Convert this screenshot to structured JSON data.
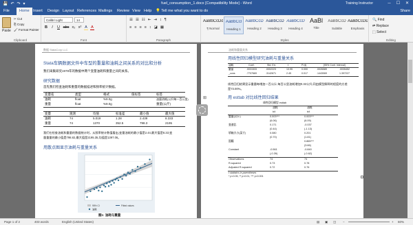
{
  "window": {
    "title": "fuel_consumption_1.docx [Compatibility Mode] - Word",
    "user": "Training Instructor",
    "quick_access": [
      "💾",
      "↶",
      "↷",
      "▾"
    ],
    "controls": {
      "minimize": "─",
      "maximize": "☐",
      "close": "✕"
    }
  },
  "tabs": [
    {
      "label": "File"
    },
    {
      "label": "Home"
    },
    {
      "label": "Insert"
    },
    {
      "label": "Design"
    },
    {
      "label": "Layout"
    },
    {
      "label": "References"
    },
    {
      "label": "Mailings"
    },
    {
      "label": "Review"
    },
    {
      "label": "View"
    },
    {
      "label": "Help"
    }
  ],
  "tell_me": "Tell me what you want to do",
  "share": "Share",
  "ribbon": {
    "clipboard": {
      "paste": "Paste",
      "cut": "Cut",
      "copy": "Copy",
      "format_painter": "Format Painter",
      "label": "Clipboard"
    },
    "font": {
      "name": "Calibri Light",
      "size": "14",
      "label": "Font",
      "buttons": [
        "B",
        "I",
        "U",
        "abc",
        "x₂",
        "x²",
        "A",
        "A"
      ]
    },
    "paragraph": {
      "label": "Paragraph",
      "row1": [
        "☰",
        "☰",
        "☷",
        "⇤",
        "⇥",
        "↕",
        "¶"
      ],
      "row2": [
        "≡",
        "≡",
        "≡",
        "≡",
        "↕",
        "◪",
        "▦"
      ]
    },
    "styles": {
      "label": "Styles",
      "items": [
        {
          "sample": "AaBbCcDd",
          "name": "¶ Normal"
        },
        {
          "sample": "AaBbCcl",
          "name": "Heading 1"
        },
        {
          "sample": "AaBbCcD",
          "name": "Heading 2"
        },
        {
          "sample": "AaBbCcD",
          "name": "Heading 3"
        },
        {
          "sample": "AaBbCcD",
          "name": "Heading 4"
        },
        {
          "sample": "AaBl",
          "name": "Title"
        },
        {
          "sample": "AaBbCcD",
          "name": "Subtitle"
        },
        {
          "sample": "AaBbCcDd",
          "name": "Emphasis"
        }
      ]
    },
    "editing": {
      "find": "Find",
      "replace": "Replace",
      "select": "Select",
      "label": "Editing"
    }
  },
  "left_page": {
    "header": "数据 StataCorp LLC",
    "title": "Stata车辆数据文件中车型的重量和油耗之间关系的对比和分析",
    "intro": "我们采集研究1978年的数据中两个变量油耗和重量之间的关系。",
    "h1": "研究数据",
    "p1": "首先我们检查油耗和重量的数据描述和频率统计数据。",
    "table1": {
      "headers": [
        "变量名",
        "类型",
        "格式",
        "值标签",
        "标签"
      ],
      "rows": [
        [
          "油耗",
          "float",
          "%9.0g",
          "",
          "油量消耗(公升每一百公里)"
        ],
        [
          "重量",
          "float",
          "%9.0g",
          "",
          "重量(公斤)"
        ]
      ]
    },
    "table2": {
      "headers": [
        "变量",
        "观测",
        "均值",
        "标准差",
        "最小值",
        "最大值"
      ],
      "rows": [
        [
          "油耗",
          "74",
          "5.019",
          "1.28",
          "2.439",
          "8.333"
        ],
        [
          "重量",
          "74",
          "1370",
          "352.5",
          "798.3",
          "2195"
        ]
      ]
    },
    "p2_line1": "我们在检查油耗和重量的数据统计时，从频率统计数值看出,变量油耗的最小值是2.44,最大值是8.33;变",
    "p2_line2": "量重量的最小值是798.82,最大值是2195.35,均值是1397.06。",
    "h2": "用散点图显示油耗与重量关系",
    "figure_caption": "图1: 油耗与重量",
    "chart_legend": [
      "95% CI",
      "Fitted values",
      "油耗"
    ]
  },
  "right_page": {
    "header": "油耗和重量关系",
    "h1": "用线性回归模型研究油耗与重量关系",
    "reg_table": {
      "headers": [
        "油耗",
        "Coef.",
        "Std. Err.",
        "t",
        "P>|t|",
        "[95% Conf. Interval]"
      ],
      "rows": [
        [
          "重量",
          ".0031533",
          ".0002223",
          "13.95",
          "0.000",
          ".0026589",
          ".0035452"
        ],
        [
          "_cons",
          ".7707669",
          ".3142671",
          "2.45",
          "0.017",
          ".1443069",
          "1.397227"
        ]
      ]
    },
    "p1_line1": "线性回归结果显示重量每增加一百公斤,每百公里油耗增加0.32公升,同由模型解释的程度的方差",
    "p1_line2": "是73.00%。",
    "h2": "用 esttab 对比线性回归结果",
    "esttab": {
      "caption": "线性回归模型 esttab",
      "col_headers": [
        "油耗",
        "油耗"
      ],
      "col_sub": [
        "b/t",
        "b/t"
      ],
      "rows": [
        {
          "label": "重量(公斤)",
          "c1": "0.003***",
          "c2": "0.003***"
        },
        {
          "label": "",
          "c1": "(6.06)",
          "c2": "(6.09)"
        },
        {
          "label": "变速比",
          "c1": "0.171",
          "c2": "-0.037"
        },
        {
          "label": "",
          "c1": "(0.44)",
          "c2": "(-1.13)"
        },
        {
          "label": "轿箱大小(英寸)",
          "c1": "0.080",
          "c2": "0.201"
        },
        {
          "label": "",
          "c1": "(0.70)",
          "c2": "(1.81)"
        },
        {
          "label": "国籍",
          "c1": "",
          "c2": "0.865***"
        },
        {
          "label": "",
          "c1": "",
          "c2": "(3.66)"
        },
        {
          "label": "Constant",
          "c1": "-0.561",
          "c2": "-0.840"
        },
        {
          "label": "",
          "c1": "(-0.39)",
          "c2": "(-0.62)"
        }
      ],
      "stats": [
        {
          "label": "Observations",
          "c1": "74",
          "c2": "74"
        },
        {
          "label": "R-squared",
          "c1": "0.73",
          "c2": "0.78"
        },
        {
          "label": "Adjusted R-squared",
          "c1": "0.72",
          "c2": "0.76"
        }
      ],
      "notes": [
        "t statistics in parentheses",
        "* p<0.05, ** p<0.01, *** p<0.001"
      ]
    }
  },
  "status": {
    "page": "Page 1 of 2",
    "words": "403 words",
    "language": "English (United States)",
    "zoom": "60%"
  },
  "chart_data": {
    "type": "scatter",
    "xlabel": "",
    "ylabel": "",
    "x_range": [
      1000,
      2000
    ],
    "y_range": [
      2,
      9
    ],
    "series": [
      {
        "name": "油耗",
        "type": "scatter",
        "points": [
          [
            850,
            2.5
          ],
          [
            920,
            3.4
          ],
          [
            1000,
            3.7
          ],
          [
            1050,
            3.9
          ],
          [
            1090,
            3.5
          ],
          [
            1120,
            4.0
          ],
          [
            1160,
            3.4
          ],
          [
            1200,
            4.3
          ],
          [
            1230,
            4.1
          ],
          [
            1260,
            4.6
          ],
          [
            1300,
            4.2
          ],
          [
            1320,
            4.8
          ],
          [
            1350,
            4.4
          ],
          [
            1380,
            5.0
          ],
          [
            1410,
            4.7
          ],
          [
            1440,
            5.2
          ],
          [
            1470,
            5.4
          ],
          [
            1500,
            5.1
          ],
          [
            1540,
            5.6
          ],
          [
            1580,
            5.3
          ],
          [
            1620,
            6.0
          ],
          [
            1660,
            5.8
          ],
          [
            1700,
            6.3
          ],
          [
            1740,
            6.1
          ],
          [
            1790,
            6.7
          ],
          [
            1850,
            6.5
          ],
          [
            1900,
            7.2
          ],
          [
            1960,
            7.0
          ],
          [
            2050,
            7.6
          ],
          [
            2150,
            8.3
          ]
        ]
      },
      {
        "name": "Fitted values",
        "type": "line",
        "points": [
          [
            800,
            3.29
          ],
          [
            2200,
            7.71
          ]
        ]
      }
    ],
    "ci_band": {
      "name": "95% CI",
      "low": [
        [
          800,
          2.95
        ],
        [
          1400,
          5.0
        ],
        [
          2200,
          7.2
        ]
      ],
      "high": [
        [
          800,
          3.65
        ],
        [
          1400,
          5.4
        ],
        [
          2200,
          8.2
        ]
      ]
    }
  }
}
